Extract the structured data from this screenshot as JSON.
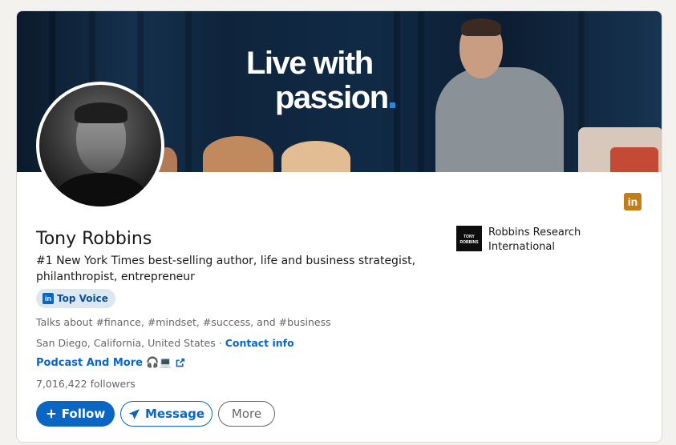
{
  "banner": {
    "line1": "Live with",
    "line2": "passion"
  },
  "profile": {
    "name": "Tony Robbins",
    "headline": "#1 New York Times best-selling author, life and business strategist, philanthropist, entrepreneur",
    "badge_label": "Top Voice",
    "badge_icon": "in",
    "talks_about": "Talks about #finance, #mindset, #success, and #business",
    "location": "San Diego, California, United States",
    "separator": " · ",
    "contact_info": "Contact info",
    "website_label": "Podcast And More",
    "website_emoji": "🎧💻",
    "followers": "7,016,422 followers"
  },
  "company": {
    "logo_line1": "TONY",
    "logo_line2": "ROBBINS",
    "name": "Robbins Research International"
  },
  "linkedin_icon": "in",
  "actions": {
    "follow": "Follow",
    "message": "Message",
    "more": "More"
  },
  "colors": {
    "accent": "#0a66c2",
    "premium_badge": "#c37d16"
  }
}
